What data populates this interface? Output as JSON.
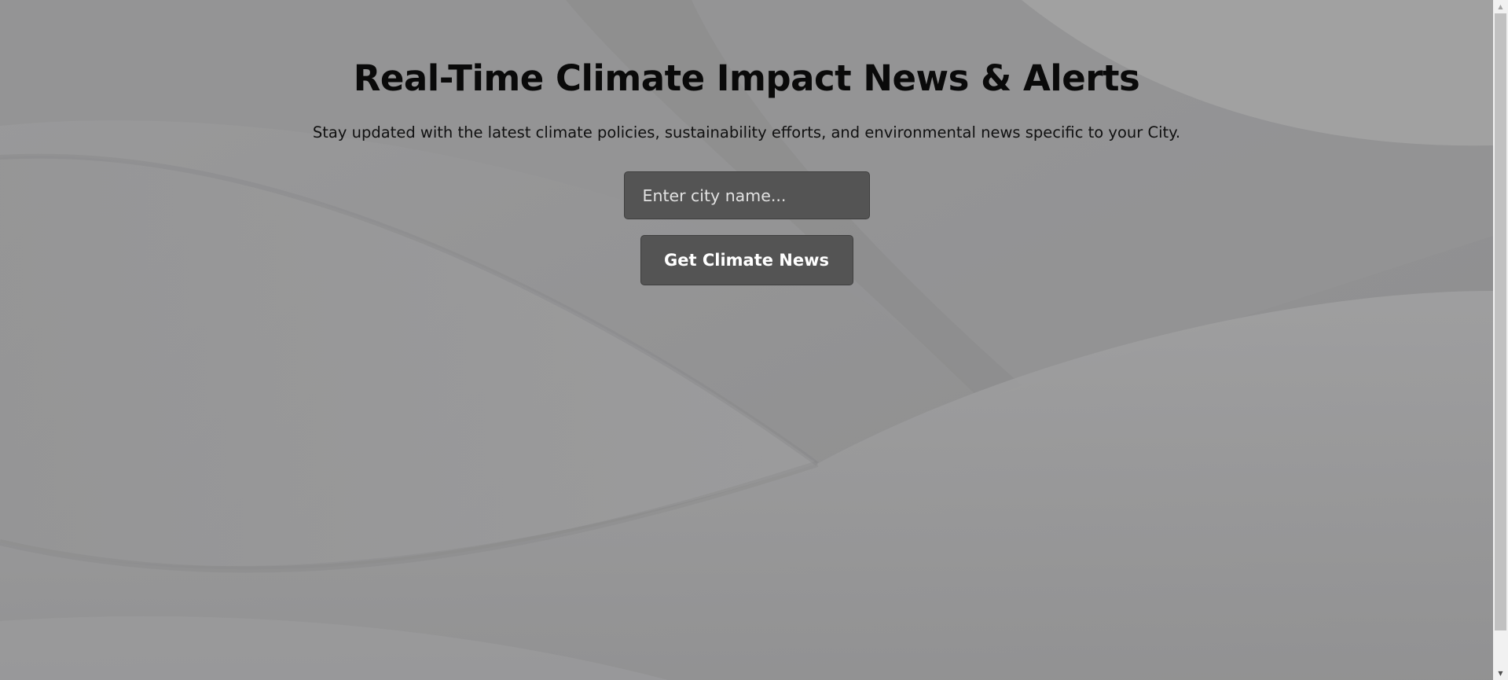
{
  "hero": {
    "title": "Real-Time Climate Impact News & Alerts",
    "subtitle": "Stay updated with the latest climate policies, sustainability efforts, and environmental news specific to your City."
  },
  "search": {
    "placeholder": "Enter city name...",
    "value": "",
    "button_label": "Get Climate News"
  },
  "scrollbar": {
    "up_icon": "▲",
    "down_icon": "▼"
  },
  "colors": {
    "background": "#929293",
    "control_bg": "#545454",
    "title_text": "#0a0a0a",
    "button_text": "#ffffff"
  },
  "icons": {
    "scroll_up": "triangle-up-icon",
    "scroll_down": "triangle-down-icon"
  }
}
